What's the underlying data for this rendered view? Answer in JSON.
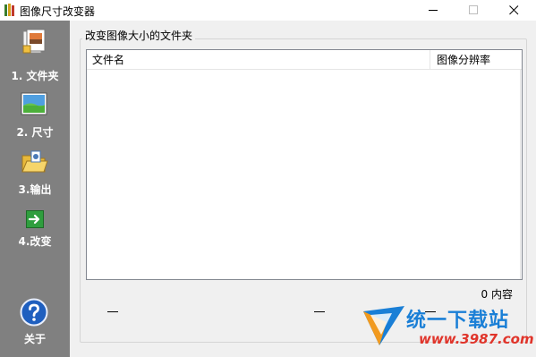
{
  "window": {
    "title": "图像尺寸改变器"
  },
  "sidebar": {
    "items": [
      {
        "label": "1. 文件夹",
        "icon": "folder-photo-icon"
      },
      {
        "label": "2. 尺寸",
        "icon": "landscape-image-icon"
      },
      {
        "label": "3.输出",
        "icon": "open-folder-output-icon"
      },
      {
        "label": "4.改变",
        "icon": "green-arrow-icon"
      }
    ],
    "about": {
      "label": "关于",
      "icon": "help-question-icon"
    }
  },
  "main": {
    "group_title": "改变图像大小的文件夹",
    "list": {
      "columns": [
        "文件名",
        "图像分辨率"
      ],
      "rows": []
    },
    "count_text": "0 内容",
    "status_dashes": [
      "—",
      "—",
      "—"
    ]
  },
  "watermark": {
    "text": "统一下载站",
    "url": "www.3987.com"
  },
  "colors": {
    "sidebar_bg": "#808080",
    "main_bg": "#f0f0f0",
    "watermark_blue": "#1a7fd6",
    "watermark_red": "#e0342a"
  }
}
